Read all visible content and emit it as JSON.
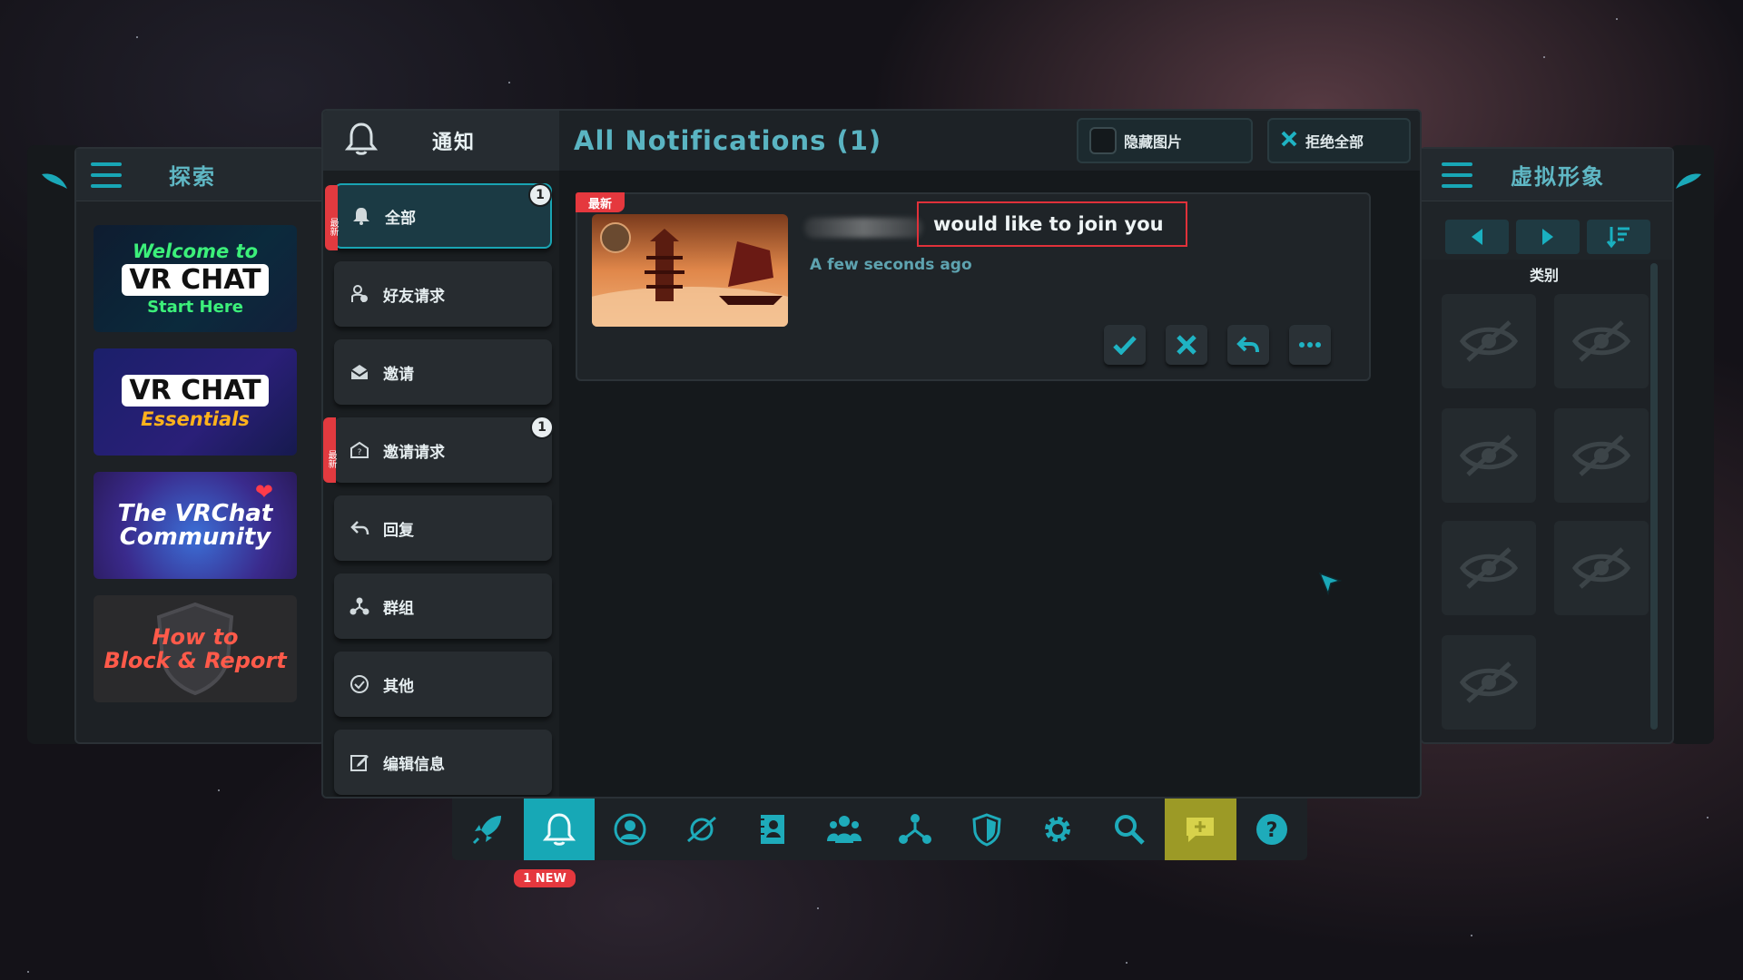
{
  "explore_panel": {
    "title": "探索",
    "tiles": [
      {
        "line1": "Welcome to",
        "line2": "VR CHAT",
        "line3": "Start Here"
      },
      {
        "line1": "VR CHAT",
        "line2": "Essentials"
      },
      {
        "line1": "The VRChat",
        "line2": "Community"
      },
      {
        "line1": "How to",
        "line2": "Block & Report"
      }
    ]
  },
  "notifications": {
    "header_title": "通知",
    "title": "All Notifications (1)",
    "hide_images_label": "隐藏图片",
    "decline_all_label": "拒绝全部",
    "categories": [
      {
        "label": "全部",
        "badge": "1",
        "new_tag": "最新"
      },
      {
        "label": "好友请求"
      },
      {
        "label": "邀请"
      },
      {
        "label": "邀请请求",
        "badge": "1",
        "new_tag": "最新"
      },
      {
        "label": "回复"
      },
      {
        "label": "群组"
      },
      {
        "label": "其他"
      },
      {
        "label": "编辑信息"
      }
    ],
    "items": [
      {
        "new_tag": "最新",
        "message": "would like to join you",
        "time": "A few seconds ago"
      }
    ]
  },
  "avatar_panel": {
    "title": "虚拟形象",
    "category_label": "类别"
  },
  "toolbar": {
    "new_badge": "1 NEW"
  },
  "colors": {
    "accent": "#17a8b6",
    "new_red": "#e5383e",
    "panel_bg": "#1d2226"
  }
}
